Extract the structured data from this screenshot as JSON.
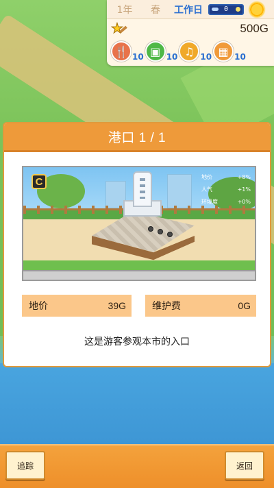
{
  "status": {
    "year": "1年",
    "season": "春",
    "day_type": "工作日",
    "time_value": "0",
    "gold": "500G",
    "resources": [
      {
        "icon": "fork-knife-icon",
        "value": "10"
      },
      {
        "icon": "shopping-bag-icon",
        "value": "10"
      },
      {
        "icon": "music-note-icon",
        "value": "10"
      },
      {
        "icon": "ticket-icon",
        "value": "10"
      }
    ]
  },
  "dialog": {
    "title": "港口 1 / 1",
    "grade": "C",
    "stats": [
      {
        "label": "地价",
        "value": "+8%"
      },
      {
        "label": "人气",
        "value": "+1%"
      },
      {
        "label": "环境度",
        "value": "+0%"
      }
    ],
    "land_price_label": "地价",
    "land_price_value": "39G",
    "maintenance_label": "维护费",
    "maintenance_value": "0G",
    "description": "这是游客参观本市的入口"
  },
  "buttons": {
    "track": "追踪",
    "back": "返回"
  },
  "colors": {
    "accent_orange": "#ee9a3a",
    "info_bg": "#fbc78a",
    "day_type_blue": "#2b6fd0"
  }
}
